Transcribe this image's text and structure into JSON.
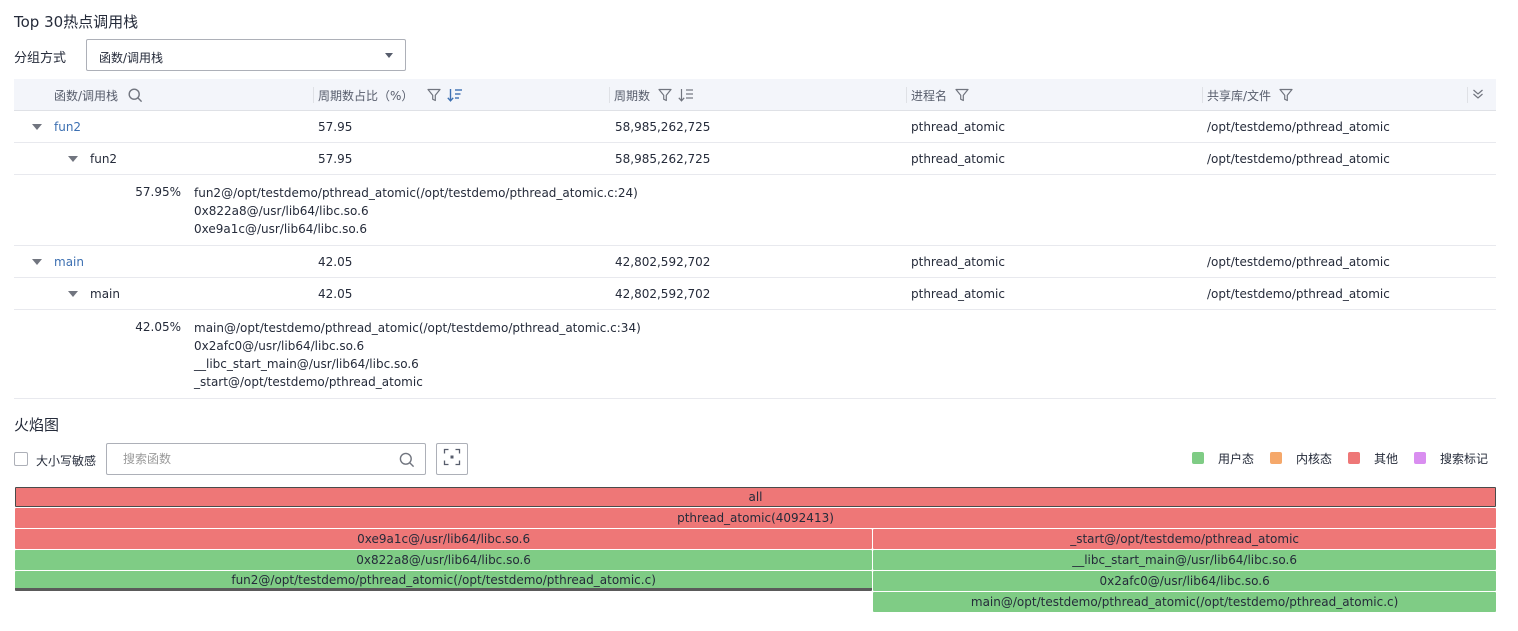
{
  "hotspot": {
    "title": "Top 30热点调用栈",
    "group_label": "分组方式",
    "group_select_value": "函数/调用栈",
    "columns": {
      "func": "函数/调用栈",
      "ratio": "周期数占比（%）",
      "cycles": "周期数",
      "process": "进程名",
      "lib": "共享库/文件"
    },
    "rows": [
      {
        "name": "fun2",
        "ratio": "57.95",
        "cycles": "58,985,262,725",
        "process": "pthread_atomic",
        "lib": "/opt/testdemo/pthread_atomic"
      },
      {
        "name": "fun2",
        "ratio": "57.95",
        "cycles": "58,985,262,725",
        "process": "pthread_atomic",
        "lib": "/opt/testdemo/pthread_atomic"
      },
      {
        "name": "main",
        "ratio": "42.05",
        "cycles": "42,802,592,702",
        "process": "pthread_atomic",
        "lib": "/opt/testdemo/pthread_atomic"
      },
      {
        "name": "main",
        "ratio": "42.05",
        "cycles": "42,802,592,702",
        "process": "pthread_atomic",
        "lib": "/opt/testdemo/pthread_atomic"
      }
    ],
    "details": [
      {
        "pct": "57.95%",
        "lines": [
          "fun2@/opt/testdemo/pthread_atomic(/opt/testdemo/pthread_atomic.c:24)",
          "0x822a8@/usr/lib64/libc.so.6",
          "0xe9a1c@/usr/lib64/libc.so.6"
        ]
      },
      {
        "pct": "42.05%",
        "lines": [
          "main@/opt/testdemo/pthread_atomic(/opt/testdemo/pthread_atomic.c:34)",
          "0x2afc0@/usr/lib64/libc.so.6",
          "__libc_start_main@/usr/lib64/libc.so.6",
          "_start@/opt/testdemo/pthread_atomic"
        ]
      }
    ]
  },
  "flame": {
    "title": "火焰图",
    "case_label": "大小写敏感",
    "case_checked": false,
    "search_placeholder": "搜索函数",
    "search_value": "",
    "legend": [
      {
        "label": "用户态",
        "color": "#7fcc85"
      },
      {
        "label": "内核态",
        "color": "#f5a86a"
      },
      {
        "label": "其他",
        "color": "#ee7777"
      },
      {
        "label": "搜索标记",
        "color": "#d98ef0"
      }
    ],
    "colors": {
      "user": "#7fcc85",
      "other": "#ee7777"
    },
    "frames": [
      {
        "label": "all",
        "type": "other",
        "depth": 0,
        "start": 0,
        "share": 1.0,
        "selected": true
      },
      {
        "label": "pthread_atomic(4092413)",
        "type": "other",
        "depth": 1,
        "start": 0,
        "share": 1.0
      },
      {
        "label": "0xe9a1c@/usr/lib64/libc.so.6",
        "type": "other",
        "depth": 2,
        "start": 0,
        "share": 0.5795
      },
      {
        "label": "_start@/opt/testdemo/pthread_atomic",
        "type": "other",
        "depth": 2,
        "start": 0.5795,
        "share": 0.4205
      },
      {
        "label": "0x822a8@/usr/lib64/libc.so.6",
        "type": "user",
        "depth": 3,
        "start": 0,
        "share": 0.5795
      },
      {
        "label": "__libc_start_main@/usr/lib64/libc.so.6",
        "type": "user",
        "depth": 3,
        "start": 0.5795,
        "share": 0.4205
      },
      {
        "label": "fun2@/opt/testdemo/pthread_atomic(/opt/testdemo/pthread_atomic.c)",
        "type": "user",
        "depth": 4,
        "start": 0,
        "share": 0.5795,
        "underline": true
      },
      {
        "label": "0x2afc0@/usr/lib64/libc.so.6",
        "type": "user",
        "depth": 4,
        "start": 0.5795,
        "share": 0.4205
      },
      {
        "label": "main@/opt/testdemo/pthread_atomic(/opt/testdemo/pthread_atomic.c)",
        "type": "user",
        "depth": 5,
        "start": 0.5795,
        "share": 0.4205
      }
    ]
  }
}
